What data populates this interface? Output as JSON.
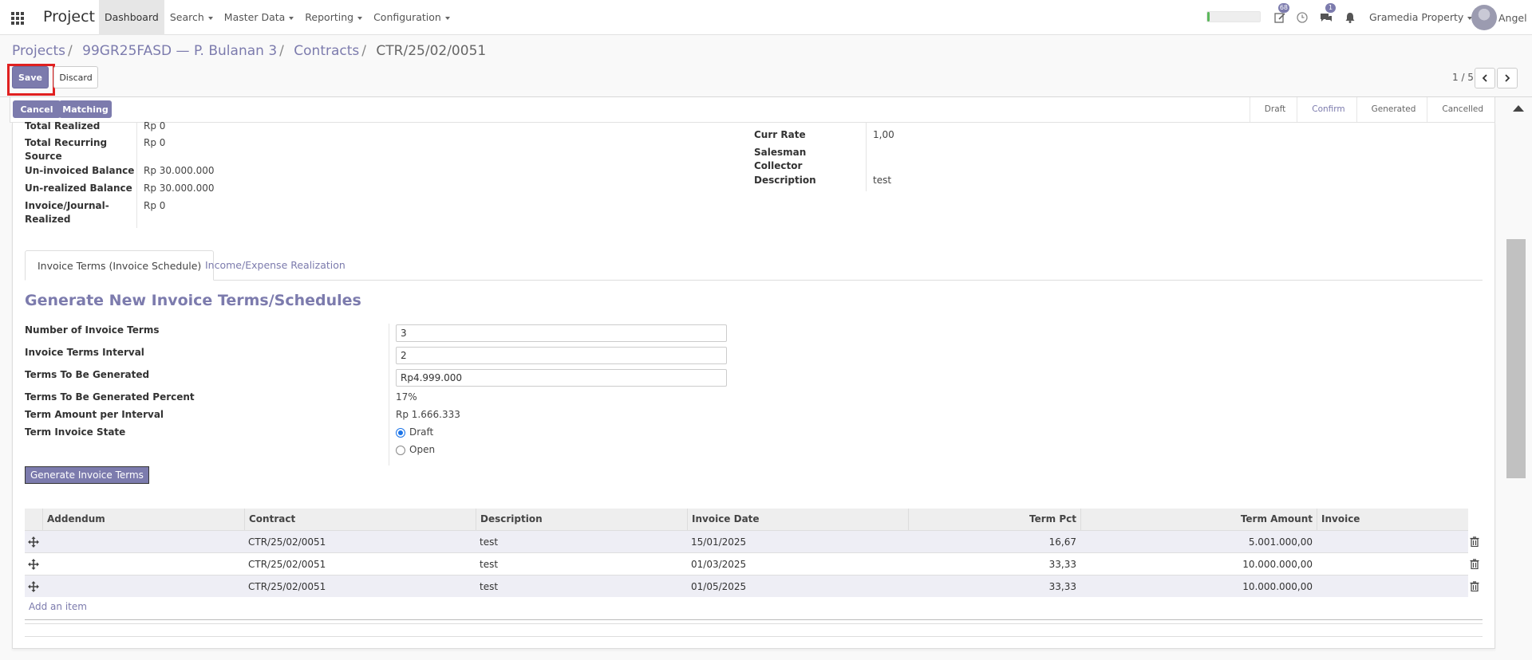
{
  "navbar": {
    "brand": "Project",
    "menu": [
      {
        "label": "Dashboard",
        "active": true,
        "caret": false
      },
      {
        "label": "Search",
        "active": false,
        "caret": true
      },
      {
        "label": "Master Data",
        "active": false,
        "caret": true
      },
      {
        "label": "Reporting",
        "active": false,
        "caret": true
      },
      {
        "label": "Configuration",
        "active": false,
        "caret": true
      }
    ],
    "activity_badge": "68",
    "messages_badge": "1",
    "company": "Gramedia Property",
    "username": "Angel",
    "progress_fraction": 0.05
  },
  "breadcrumb": {
    "items": [
      "Projects",
      "99GR25FASD — P. Bulanan 3",
      "Contracts"
    ],
    "current": "CTR/25/02/0051"
  },
  "buttons": {
    "save": "Save",
    "discard": "Discard",
    "cancel": "Cancel",
    "matching": "Matching"
  },
  "pager": {
    "value": "1 / 5"
  },
  "stages": [
    "Draft",
    "Confirm",
    "Generated",
    "Cancelled"
  ],
  "current_stage": "Confirm",
  "summary_left": [
    {
      "label": "Total Realized",
      "value": "Rp 0"
    },
    {
      "label": "Total Recurring Source",
      "value": "Rp 0"
    },
    {
      "label": "Un-invoiced Balance",
      "value": "Rp 30.000.000"
    },
    {
      "label": "Un-realized Balance",
      "value": "Rp 30.000.000"
    },
    {
      "label": "Invoice/Journal-Realized",
      "value": "Rp 0"
    }
  ],
  "summary_right": [
    {
      "label": "Curr Rate",
      "value": "1,00"
    },
    {
      "label": "Salesman",
      "value": ""
    },
    {
      "label": "Collector",
      "value": ""
    },
    {
      "label": "Description",
      "value": "test"
    }
  ],
  "tabs": [
    "Invoice Terms (Invoice Schedule)",
    "Income/Expense Realization"
  ],
  "generate": {
    "title": "Generate New Invoice Terms/Schedules",
    "fields": {
      "num_terms_label": "Number of Invoice Terms",
      "num_terms_value": "3",
      "interval_label": "Invoice Terms Interval",
      "interval_value": "2",
      "to_generate_label": "Terms To Be Generated",
      "to_generate_value": "Rp4.999.000",
      "percent_label": "Terms To Be Generated Percent",
      "percent_value": "17%",
      "amount_label": "Term Amount per Interval",
      "amount_value": "Rp 1.666.333",
      "state_label": "Term Invoice State",
      "state_options": [
        "Draft",
        "Open"
      ],
      "state_selected": "Draft"
    },
    "button": "Generate Invoice Terms"
  },
  "table": {
    "columns": [
      "Addendum",
      "Contract",
      "Description",
      "Invoice Date",
      "Term Pct",
      "Term Amount",
      "Invoice"
    ],
    "rows": [
      {
        "addendum": "",
        "contract": "CTR/25/02/0051",
        "description": "test",
        "date": "15/01/2025",
        "pct": "16,67",
        "amount": "5.001.000,00",
        "invoice": ""
      },
      {
        "addendum": "",
        "contract": "CTR/25/02/0051",
        "description": "test",
        "date": "01/03/2025",
        "pct": "33,33",
        "amount": "10.000.000,00",
        "invoice": ""
      },
      {
        "addendum": "",
        "contract": "CTR/25/02/0051",
        "description": "test",
        "date": "01/05/2025",
        "pct": "33,33",
        "amount": "10.000.000,00",
        "invoice": ""
      }
    ],
    "add_item": "Add an item"
  },
  "colors": {
    "primary": "#7c7bad",
    "highlight": "#e02020",
    "progress": "#5cb85c"
  }
}
